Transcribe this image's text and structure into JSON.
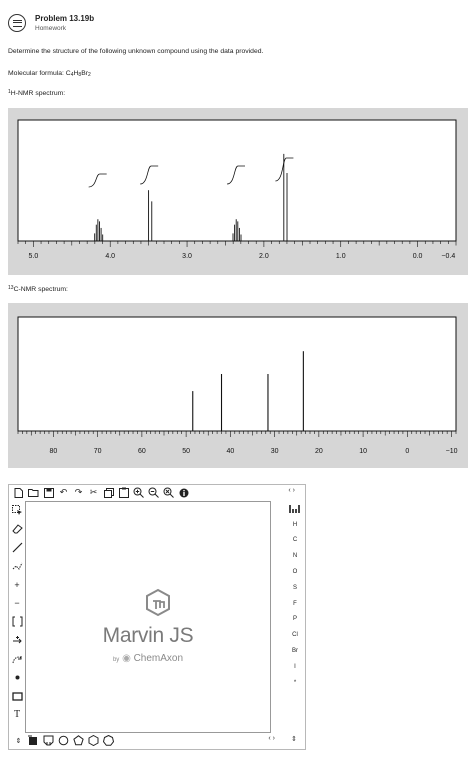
{
  "header": {
    "title": "Problem 13.19b",
    "subtitle": "Homework"
  },
  "question": {
    "instruction": "Determine the structure of the following unknown compound using the data provided.",
    "formula_label": "Molecular formula: C",
    "formula_c": "4",
    "formula_h_label": "H",
    "formula_h": "8",
    "formula_br_label": "Br",
    "formula_br": "2",
    "hnmr_sup": "1",
    "hnmr_label": "H-NMR spectrum:",
    "cnmr_sup": "13",
    "cnmr_label": "C-NMR spectrum:"
  },
  "chart_data": [
    {
      "type": "line",
      "xlim": [
        5.2,
        -0.5
      ],
      "x_reversed": true,
      "tick_labels": [
        "5.0",
        "4.0",
        "3.0",
        "2.0",
        "1.0",
        "0.0",
        "−0.4"
      ],
      "tick_values": [
        5.0,
        4.0,
        3.0,
        2.0,
        1.0,
        0.0,
        -0.4
      ],
      "peaks": [
        {
          "shift": 4.15,
          "multiplicity": "multiplet",
          "relative_height": 0.18,
          "integral": 1
        },
        {
          "shift": 3.48,
          "multiplicity": "doublet",
          "relative_height": 0.42,
          "integral": 2
        },
        {
          "shift": 2.35,
          "multiplicity": "multiplet",
          "relative_height": 0.18,
          "integral": 2
        },
        {
          "shift": 1.72,
          "multiplicity": "doublet",
          "relative_height": 0.72,
          "integral": 3
        }
      ],
      "grid": false
    },
    {
      "type": "line",
      "xlim": [
        88,
        -11
      ],
      "x_reversed": true,
      "tick_labels": [
        "80",
        "70",
        "60",
        "50",
        "40",
        "30",
        "20",
        "10",
        "0",
        "−10"
      ],
      "tick_values": [
        80,
        70,
        60,
        50,
        40,
        30,
        20,
        10,
        0,
        -10
      ],
      "peaks": [
        {
          "shift": 48.5,
          "relative_height": 0.35
        },
        {
          "shift": 42.0,
          "relative_height": 0.5
        },
        {
          "shift": 31.5,
          "relative_height": 0.5
        },
        {
          "shift": 23.5,
          "relative_height": 0.7
        }
      ],
      "grid": false
    }
  ],
  "editor": {
    "logo_text": "Marvin JS",
    "by_text": "by",
    "brand_text": "ChemAxon",
    "right_nav": "‹ ›",
    "bottom_nav": "‹ ›",
    "elements": [
      "H",
      "C",
      "N",
      "O",
      "S",
      "F",
      "P",
      "Cl",
      "Br",
      "I",
      "*"
    ],
    "top_tools": [
      "new-document-icon",
      "open-folder-icon",
      "save-icon",
      "undo-icon",
      "redo-icon",
      "cut-icon",
      "copy-icon",
      "paste-icon",
      "zoom-in-icon",
      "zoom-out-icon",
      "zoom-fit-icon",
      "info-icon"
    ],
    "left_tools": [
      "select-tool-icon",
      "eraser-icon",
      "bond-icon",
      "chain-icon",
      "plus-charge-icon",
      "minus-charge-icon",
      "bracket-icon",
      "reaction-arrow-icon",
      "curved-arrow-icon",
      "atom-dot-icon",
      "rectangle-icon",
      "text-tool-icon"
    ],
    "bottom_tools": [
      "template-scroll-icon",
      "benzene-template-icon",
      "cyclopropane-template-icon",
      "cyclobutane-template-icon",
      "cyclopentane-template-icon",
      "cyclohexane-template-icon",
      "cycloheptane-template-icon"
    ]
  }
}
